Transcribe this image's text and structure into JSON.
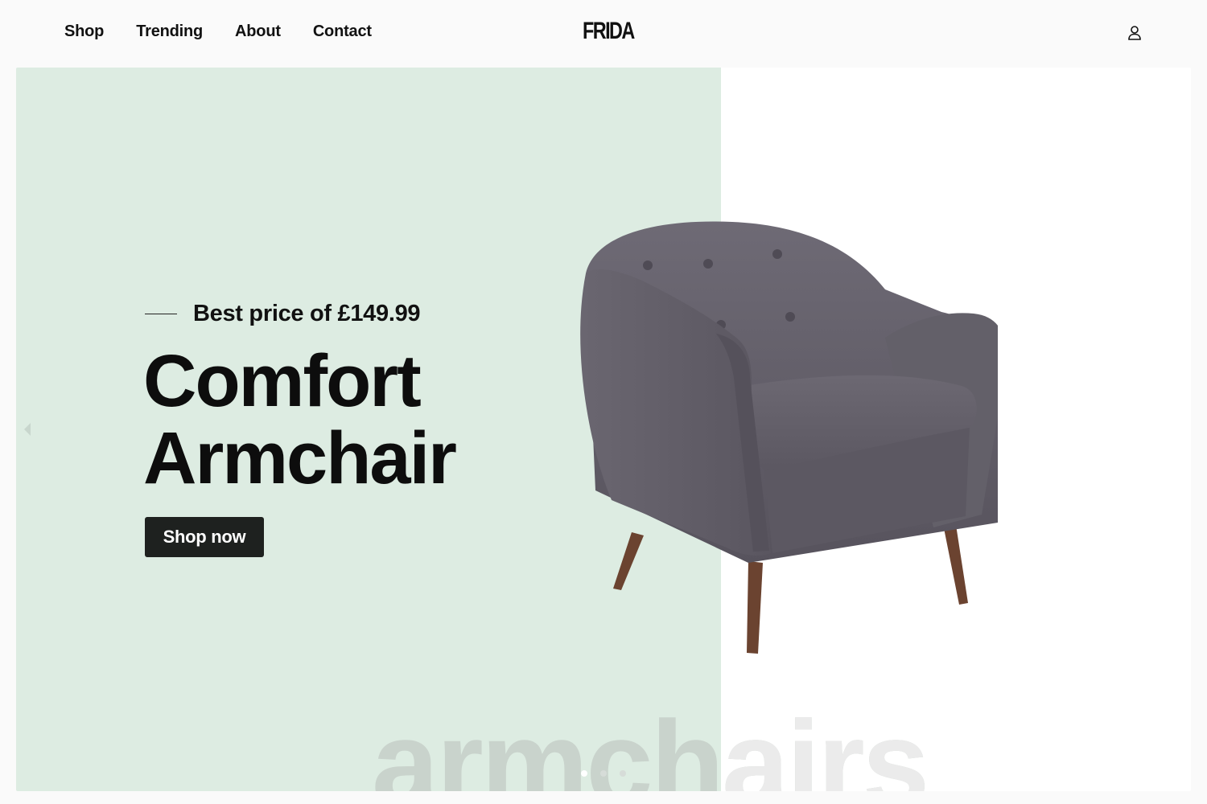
{
  "header": {
    "nav": [
      {
        "label": "Shop"
      },
      {
        "label": "Trending"
      },
      {
        "label": "About"
      },
      {
        "label": "Contact"
      }
    ],
    "logo": "FRIDA",
    "account_icon": "user-icon"
  },
  "hero": {
    "eyebrow": "Best price of £149.99",
    "title_line1": "Comfort",
    "title_line2": "Armchair",
    "cta_label": "Shop now",
    "background_word": "armchairs",
    "prev_icon": "chevron-left-icon",
    "slides_total": 3,
    "active_slide": 1,
    "colors": {
      "panel": "#ddece2",
      "button": "#1e211f",
      "upholstery": "#5f5b66",
      "legs": "#6b4330"
    }
  }
}
